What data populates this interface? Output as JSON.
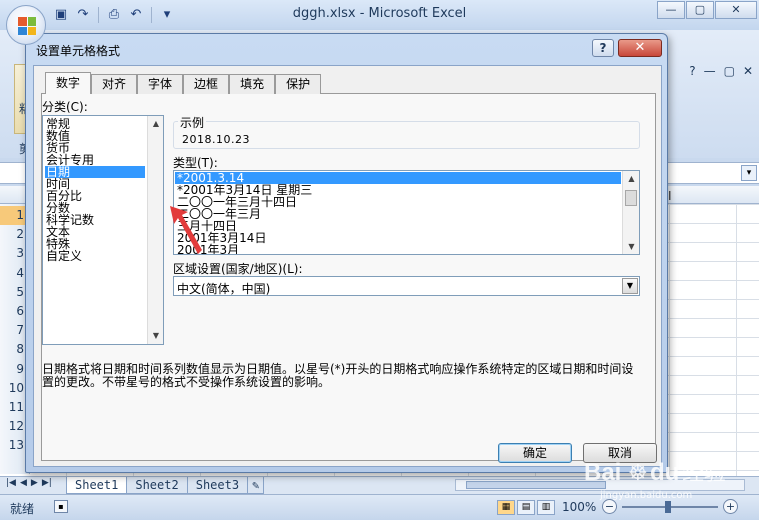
{
  "app": {
    "title": "dggh.xlsx - Microsoft Excel",
    "window_controls": [
      "—",
      "▢",
      "✕"
    ],
    "ribbon_controls": [
      "?",
      "—",
      "▢",
      "✕"
    ],
    "ribbon_left_labels": [
      "粘",
      "剪"
    ]
  },
  "qat": {
    "buttons": [
      "save-icon",
      "redo-icon",
      "print-preview-icon",
      "undo-icon",
      "customize-icon"
    ]
  },
  "sheet": {
    "column_label": "I",
    "rows": [
      "1",
      "2",
      "3",
      "4",
      "5",
      "6",
      "7",
      "8",
      "9",
      "10",
      "11",
      "12",
      "13"
    ],
    "active_row": "1",
    "tabs": [
      "Sheet1",
      "Sheet2",
      "Sheet3"
    ],
    "nav_arrows": [
      "|◀",
      "◀",
      "▶",
      "▶|"
    ]
  },
  "status": {
    "text": "就绪",
    "zoom": "100%",
    "zoom_minus": "−",
    "zoom_plus": "+",
    "zoom_level": 0.5
  },
  "dialog": {
    "title": "设置单元格格式",
    "help": "?",
    "close": "✕",
    "tabs": [
      "数字",
      "对齐",
      "字体",
      "边框",
      "填充",
      "保护"
    ],
    "active_tab": "数字",
    "category_label": "分类(C):",
    "categories": [
      "常规",
      "数值",
      "货币",
      "会计专用",
      "日期",
      "时间",
      "百分比",
      "分数",
      "科学记数",
      "文本",
      "特殊",
      "自定义"
    ],
    "selected_category": "日期",
    "sample_label": "示例",
    "sample_value": "2018.10.23",
    "type_label": "类型(T):",
    "types": [
      "*2001.3.14",
      "*2001年3月14日 星期三",
      "二〇〇一年三月十四日",
      "二〇〇一年三月",
      "三月十四日",
      "2001年3月14日",
      "2001年3月"
    ],
    "selected_type": "*2001.3.14",
    "locale_label": "区域设置(国家/地区)(L):",
    "locale_value": "中文(简体，中国)",
    "description": "日期格式将日期和时间系列数值显示为日期值。以星号(*)开头的日期格式响应操作系统特定的区域日期和时间设置的更改。不带星号的格式不受操作系统设置的影响。",
    "ok": "确定",
    "cancel": "取消"
  },
  "annotation": {
    "arrow_color": "#e23b3b"
  },
  "watermark": {
    "text": "Bai du 经验",
    "subtext": "jingyan.baidu.com"
  },
  "colors": {
    "selection": "#3399ff",
    "dialog_frame": "#b5cbe9",
    "excel_chrome": "#c9d9ee"
  }
}
